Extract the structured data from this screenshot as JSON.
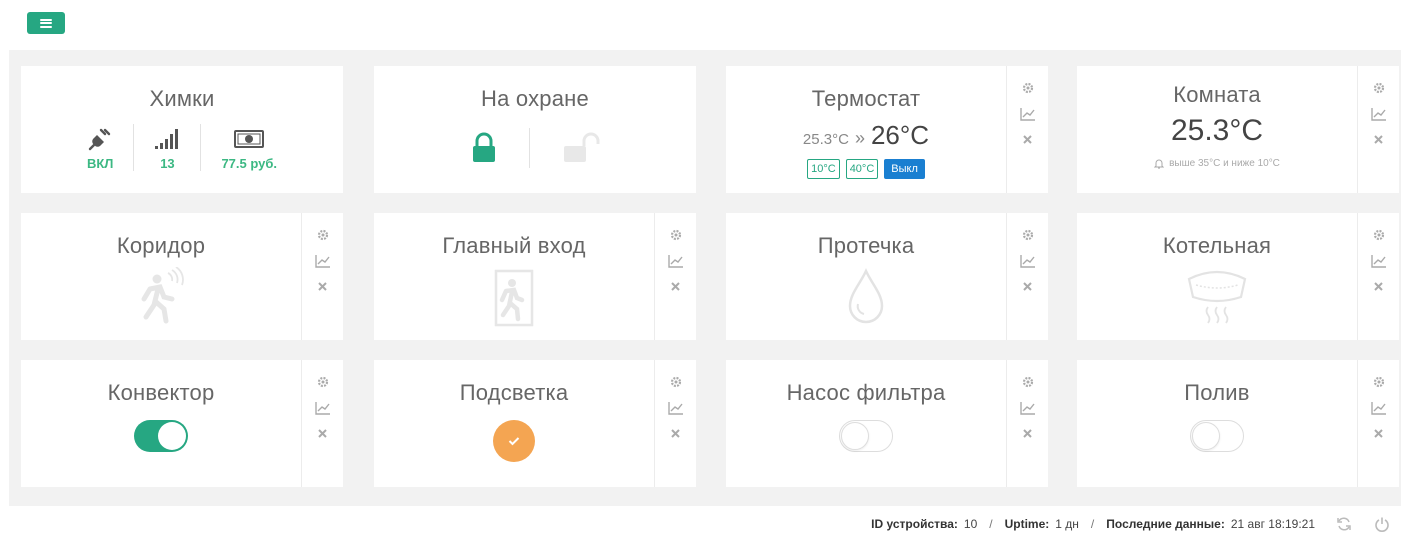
{
  "menu": {
    "icon": "hamburger-icon"
  },
  "widgets": {
    "khimki": {
      "title": "Химки",
      "power": {
        "icon": "plug-icon",
        "value": "ВКЛ"
      },
      "signal": {
        "icon": "signal-bars-icon",
        "value": "13"
      },
      "balance": {
        "icon": "money-icon",
        "value": "77.5 руб."
      }
    },
    "guard": {
      "title": "На охране",
      "locked_icon": "lock-closed-icon",
      "unlocked_icon": "lock-open-icon"
    },
    "thermostat": {
      "title": "Термостат",
      "current": "25.3°C",
      "arrow": "»",
      "target": "26°C",
      "min_btn": "10°C",
      "max_btn": "40°C",
      "off_btn": "Выкл"
    },
    "room": {
      "title": "Комната",
      "temperature": "25.3°C",
      "alert": "выше 35°C и ниже 10°C"
    },
    "corridor": {
      "title": "Коридор",
      "icon": "motion-sensor-icon"
    },
    "main_entrance": {
      "title": "Главный вход",
      "icon": "door-exit-icon"
    },
    "leak": {
      "title": "Протечка",
      "icon": "water-drop-icon"
    },
    "boiler_room": {
      "title": "Котельная",
      "icon": "smoke-detector-icon"
    },
    "convector": {
      "title": "Конвектор",
      "state": "on"
    },
    "backlight": {
      "title": "Подсветка",
      "state": "checked"
    },
    "filter_pump": {
      "title": "Насос фильтра",
      "state": "off"
    },
    "watering": {
      "title": "Полив",
      "state": "off"
    }
  },
  "footer": {
    "device_id_label": "ID устройства:",
    "device_id_value": "10",
    "uptime_label": "Uptime:",
    "uptime_value": "1 дн",
    "last_data_label": "Последние данные:",
    "last_data_value": "21 авг 18:19:21",
    "separator": "/"
  },
  "colors": {
    "accent": "#26a782",
    "value_green": "#3cb883",
    "off_button": "#1a7fd1",
    "orange": "#f4a552",
    "panel_bg": "#f2f2f2"
  }
}
